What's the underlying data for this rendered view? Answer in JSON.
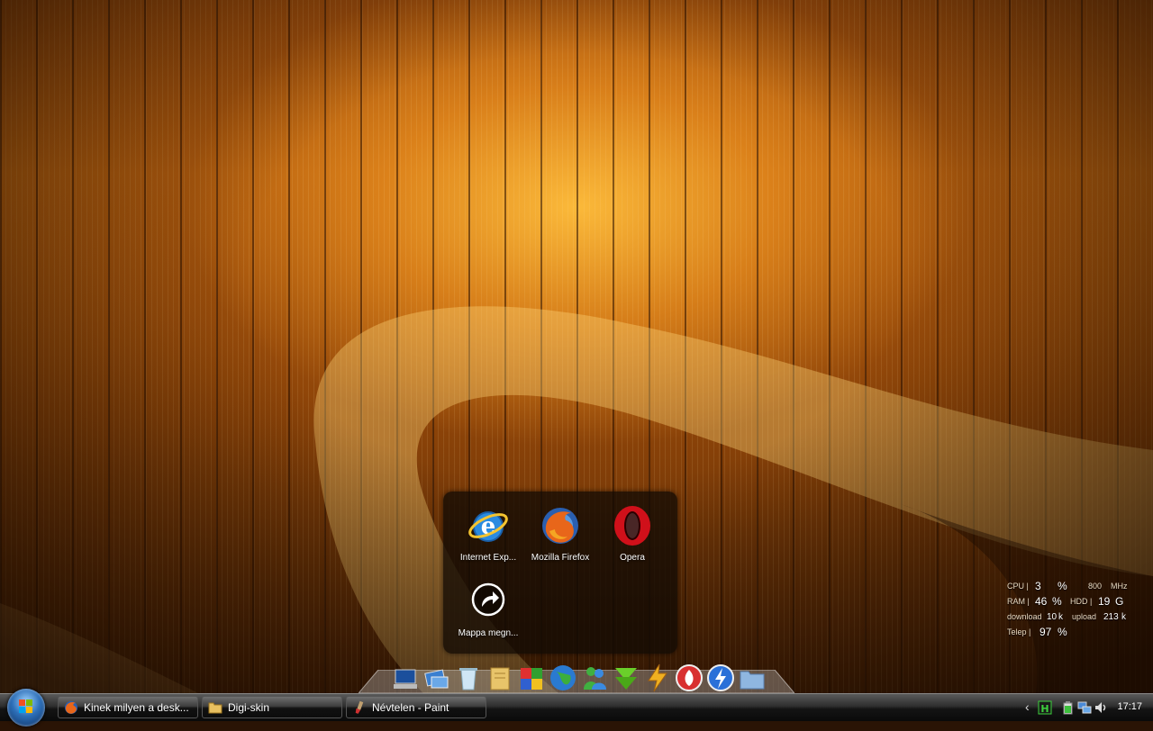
{
  "stack": {
    "items": [
      {
        "label": "Internet Exp...",
        "icon": "internet-explorer-icon"
      },
      {
        "label": "Mozilla Firefox",
        "icon": "firefox-icon"
      },
      {
        "label": "Opera",
        "icon": "opera-icon"
      },
      {
        "label": "Mappa megn...",
        "icon": "open-folder-arrow-icon"
      }
    ]
  },
  "dock": {
    "icons": [
      "computer-icon",
      "network-icon",
      "recycle-bin-icon",
      "documents-icon",
      "office-icon",
      "globe-icon",
      "messenger-icon",
      "download-icon",
      "winamp-icon",
      "burning-icon",
      "speed-icon",
      "folder-icon"
    ]
  },
  "sysmon": {
    "cpu_label": "CPU |",
    "cpu_value": "3",
    "cpu_unit": "%",
    "cpu_freq": "800",
    "cpu_freq_unit": "MHz",
    "ram_label": "RAM |",
    "ram_value": "46",
    "ram_unit": "%",
    "hdd_label": "HDD |",
    "hdd_value": "19",
    "hdd_unit": "G",
    "download_label": "download",
    "download_value": "10",
    "download_unit": "k",
    "upload_label": "upload",
    "upload_value": "213",
    "upload_unit": "k",
    "battery_label": "Telep |",
    "battery_value": "97",
    "battery_unit": "%"
  },
  "taskbar": {
    "buttons": [
      {
        "label": "Kinek milyen a desk...",
        "icon": "firefox-icon"
      },
      {
        "label": "Digi-skin",
        "icon": "folder-icon"
      },
      {
        "label": "Névtelen - Paint",
        "icon": "paint-icon"
      }
    ],
    "tray": {
      "chevron": "‹",
      "clock": "17:17"
    }
  },
  "colors": {
    "wallpaper_accent": "#e89a2a",
    "taskbar_bg": "#141414"
  }
}
